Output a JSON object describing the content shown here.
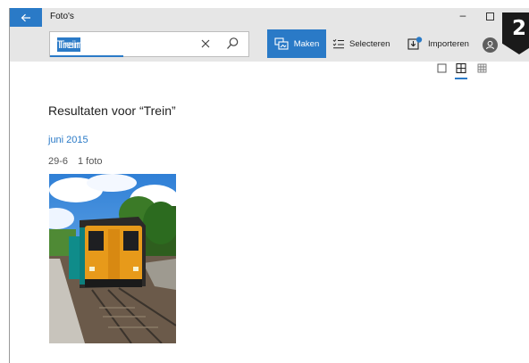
{
  "window": {
    "title": "Foto's",
    "minimize_glyph": "–"
  },
  "search": {
    "value": "Trein"
  },
  "toolbar": {
    "maken_label": "Maken",
    "selecteren_label": "Selecteren",
    "importeren_label": "Importeren",
    "more_glyph": "···"
  },
  "badge": {
    "number": "2"
  },
  "results": {
    "title": "Resultaten voor “Trein”",
    "month": "juni 2015",
    "group_date": "29-6",
    "group_count": "1 foto"
  },
  "colors": {
    "accent": "#2a7ac7",
    "chrome": "#e6e6e6"
  },
  "icons": [
    "back-arrow-icon",
    "clear-icon",
    "search-icon",
    "slideshow-icon",
    "select-list-icon",
    "import-icon",
    "user-icon",
    "view-single-icon",
    "view-medium-grid-icon",
    "view-small-grid-icon"
  ]
}
